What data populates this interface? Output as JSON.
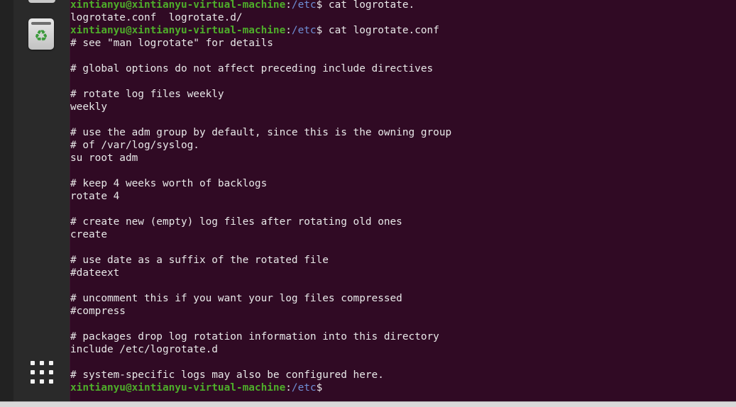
{
  "terminal": {
    "user_host": "xintianyu@xintianyu-virtual-machine",
    "path": "/etc",
    "prompt_symbol": "$",
    "lines": [
      {
        "type": "prompt",
        "command": " cat logrotate."
      },
      {
        "type": "text",
        "text": "logrotate.conf  logrotate.d/"
      },
      {
        "type": "prompt",
        "command": " cat logrotate.conf"
      },
      {
        "type": "text",
        "text": "# see \"man logrotate\" for details"
      },
      {
        "type": "text",
        "text": ""
      },
      {
        "type": "text",
        "text": "# global options do not affect preceding include directives"
      },
      {
        "type": "text",
        "text": ""
      },
      {
        "type": "text",
        "text": "# rotate log files weekly"
      },
      {
        "type": "text",
        "text": "weekly"
      },
      {
        "type": "text",
        "text": ""
      },
      {
        "type": "text",
        "text": "# use the adm group by default, since this is the owning group"
      },
      {
        "type": "text",
        "text": "# of /var/log/syslog."
      },
      {
        "type": "text",
        "text": "su root adm"
      },
      {
        "type": "text",
        "text": ""
      },
      {
        "type": "text",
        "text": "# keep 4 weeks worth of backlogs"
      },
      {
        "type": "text",
        "text": "rotate 4"
      },
      {
        "type": "text",
        "text": ""
      },
      {
        "type": "text",
        "text": "# create new (empty) log files after rotating old ones"
      },
      {
        "type": "text",
        "text": "create"
      },
      {
        "type": "text",
        "text": ""
      },
      {
        "type": "text",
        "text": "# use date as a suffix of the rotated file"
      },
      {
        "type": "text",
        "text": "#dateext"
      },
      {
        "type": "text",
        "text": ""
      },
      {
        "type": "text",
        "text": "# uncomment this if you want your log files compressed"
      },
      {
        "type": "text",
        "text": "#compress"
      },
      {
        "type": "text",
        "text": ""
      },
      {
        "type": "text",
        "text": "# packages drop log rotation information into this directory"
      },
      {
        "type": "text",
        "text": "include /etc/logrotate.d"
      },
      {
        "type": "text",
        "text": ""
      },
      {
        "type": "text",
        "text": "# system-specific logs may also be configured here."
      },
      {
        "type": "prompt",
        "command": " "
      }
    ]
  },
  "dock": {
    "items": [
      {
        "name": "trash-icon",
        "icon": "recycle",
        "glyph": "♻"
      },
      {
        "name": "show-applications-icon",
        "icon": "grid"
      }
    ]
  },
  "colors": {
    "terminal_bg": "#300a24",
    "user_host": "#4ead2a",
    "path": "#6f8fd6",
    "text": "#e8e8e8",
    "dock_bg": "#2a2a2a"
  }
}
